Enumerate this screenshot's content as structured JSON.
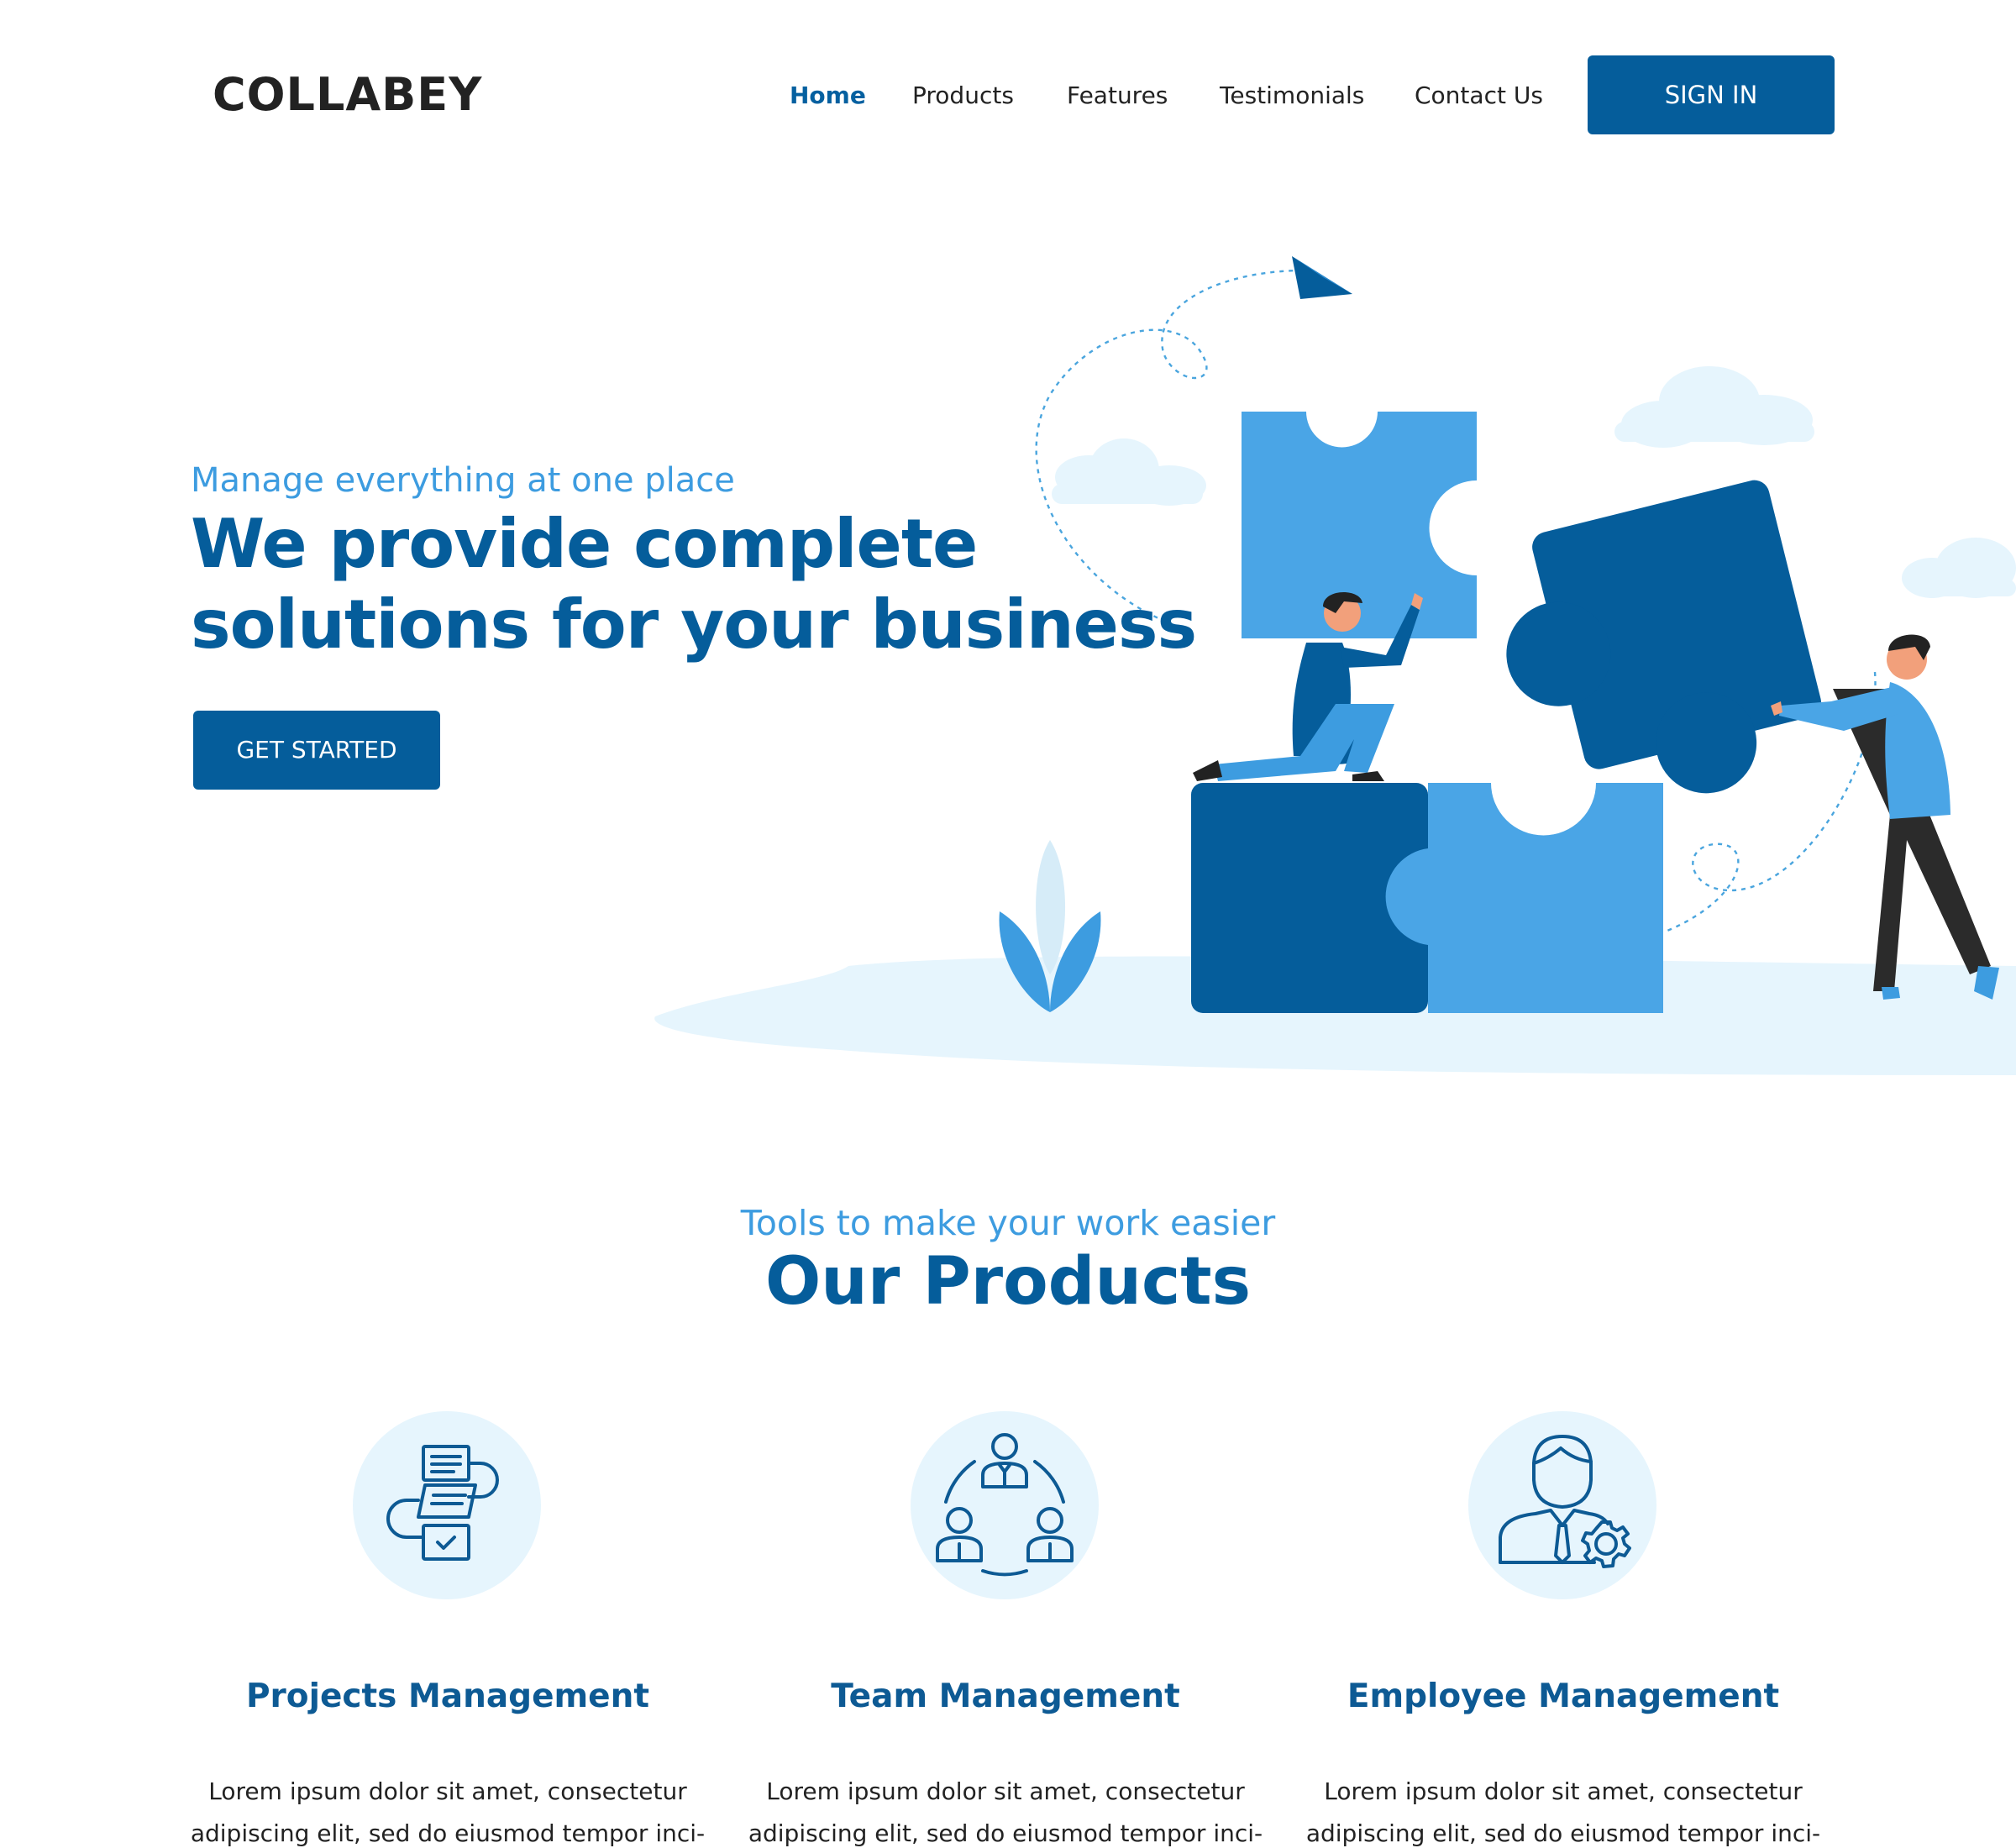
{
  "brand": {
    "logo_text": "COLLABEY"
  },
  "colors": {
    "primary": "#055d9b",
    "accent": "#3d9ce0",
    "light_bg": "#e6f5fd",
    "text": "#222222"
  },
  "nav": {
    "items": [
      {
        "label": "Home",
        "active": true
      },
      {
        "label": "Products",
        "active": false
      },
      {
        "label": "Features",
        "active": false
      },
      {
        "label": "Testimonials",
        "active": false
      },
      {
        "label": "Contact Us",
        "active": false
      }
    ],
    "signin_label": "SIGN IN"
  },
  "hero": {
    "eyebrow": "Manage everything at one place",
    "title_line1": "We provide complete",
    "title_line2": "solutions for your business",
    "cta_label": "GET STARTED"
  },
  "products": {
    "eyebrow": "Tools to make your work easier",
    "title": "Our Products",
    "items": [
      {
        "icon": "workflow-icon",
        "name": "Projects Management",
        "description": "Lorem ipsum dolor sit amet, consectetur adipiscing elit, sed do eiusmod tempor inci-"
      },
      {
        "icon": "team-icon",
        "name": "Team Management",
        "description": "Lorem ipsum dolor sit amet, consectetur adipiscing elit, sed do eiusmod tempor inci-"
      },
      {
        "icon": "employee-gear-icon",
        "name": "Employee Management",
        "description": "Lorem ipsum dolor sit amet, consectetur adipiscing elit, sed do eiusmod tempor inci-"
      }
    ]
  }
}
